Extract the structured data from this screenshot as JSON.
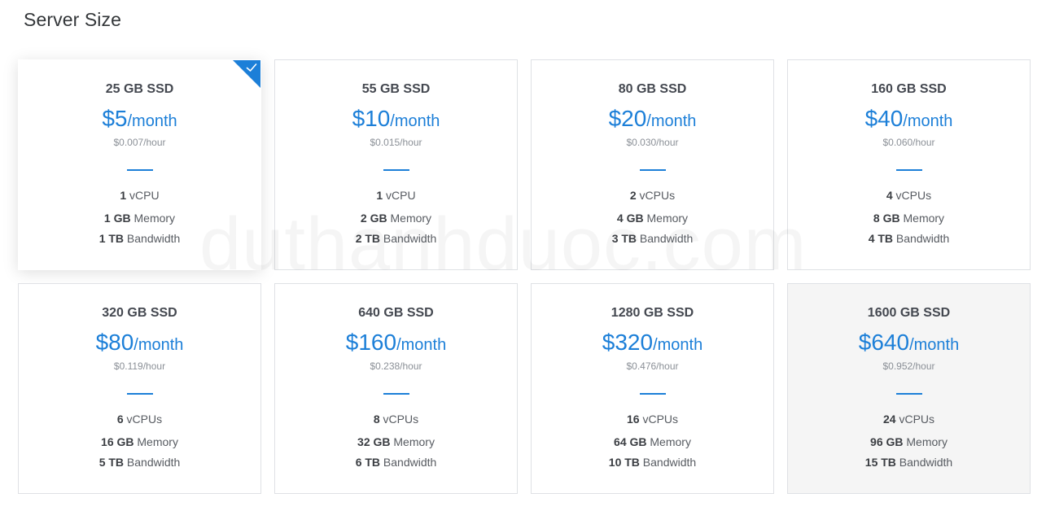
{
  "section_title": "Server Size",
  "watermark": "duthanhduoc.com",
  "accent_color": "#1c7fd8",
  "plans": [
    {
      "disk": "25 GB SSD",
      "price": "$5",
      "period": "/month",
      "hourly": "$0.007/hour",
      "cpu_num": "1",
      "cpu_unit": " vCPU",
      "mem_num": "1 GB",
      "mem_unit": " Memory",
      "bw_num": "1 TB",
      "bw_unit": " Bandwidth",
      "selected": true
    },
    {
      "disk": "55 GB SSD",
      "price": "$10",
      "period": "/month",
      "hourly": "$0.015/hour",
      "cpu_num": "1",
      "cpu_unit": " vCPU",
      "mem_num": "2 GB",
      "mem_unit": " Memory",
      "bw_num": "2 TB",
      "bw_unit": " Bandwidth"
    },
    {
      "disk": "80 GB SSD",
      "price": "$20",
      "period": "/month",
      "hourly": "$0.030/hour",
      "cpu_num": "2",
      "cpu_unit": " vCPUs",
      "mem_num": "4 GB",
      "mem_unit": " Memory",
      "bw_num": "3 TB",
      "bw_unit": " Bandwidth"
    },
    {
      "disk": "160 GB SSD",
      "price": "$40",
      "period": "/month",
      "hourly": "$0.060/hour",
      "cpu_num": "4",
      "cpu_unit": " vCPUs",
      "mem_num": "8 GB",
      "mem_unit": " Memory",
      "bw_num": "4 TB",
      "bw_unit": " Bandwidth"
    },
    {
      "disk": "320 GB SSD",
      "price": "$80",
      "period": "/month",
      "hourly": "$0.119/hour",
      "cpu_num": "6",
      "cpu_unit": " vCPUs",
      "mem_num": "16 GB",
      "mem_unit": " Memory",
      "bw_num": "5 TB",
      "bw_unit": " Bandwidth"
    },
    {
      "disk": "640 GB SSD",
      "price": "$160",
      "period": "/month",
      "hourly": "$0.238/hour",
      "cpu_num": "8",
      "cpu_unit": " vCPUs",
      "mem_num": "32 GB",
      "mem_unit": " Memory",
      "bw_num": "6 TB",
      "bw_unit": " Bandwidth"
    },
    {
      "disk": "1280 GB SSD",
      "price": "$320",
      "period": "/month",
      "hourly": "$0.476/hour",
      "cpu_num": "16",
      "cpu_unit": " vCPUs",
      "mem_num": "64 GB",
      "mem_unit": " Memory",
      "bw_num": "10 TB",
      "bw_unit": " Bandwidth"
    },
    {
      "disk": "1600 GB SSD",
      "price": "$640",
      "period": "/month",
      "hourly": "$0.952/hour",
      "cpu_num": "24",
      "cpu_unit": " vCPUs",
      "mem_num": "96 GB",
      "mem_unit": " Memory",
      "bw_num": "15 TB",
      "bw_unit": " Bandwidth",
      "disabled": true
    }
  ]
}
